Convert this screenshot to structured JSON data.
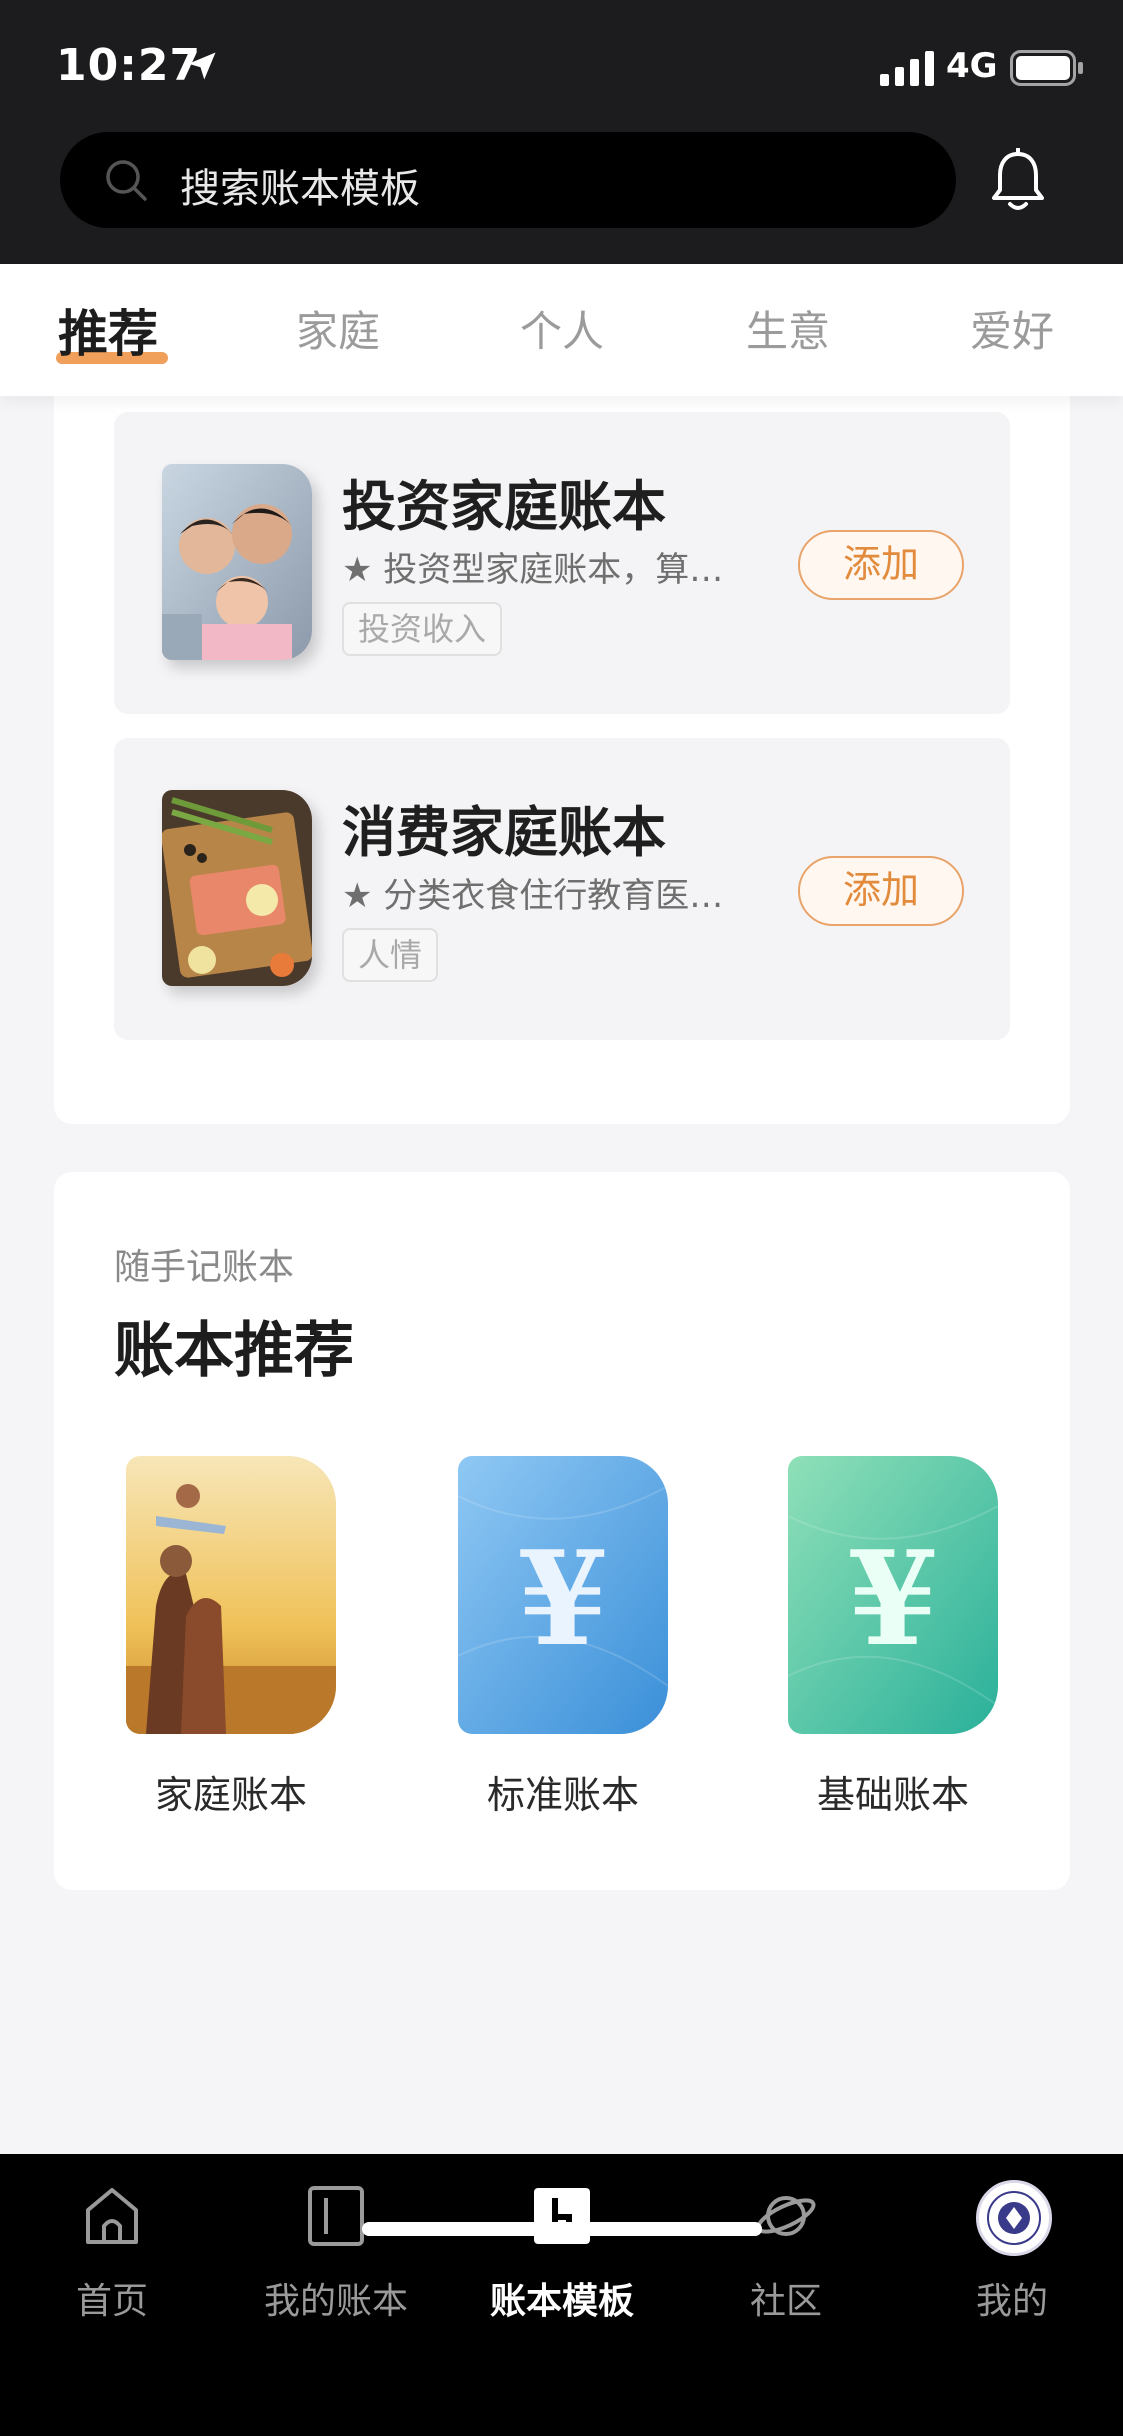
{
  "status": {
    "time": "10:27",
    "network": "4G"
  },
  "search": {
    "placeholder": "搜索账本模板"
  },
  "tabs": [
    {
      "label": "推荐",
      "active": true
    },
    {
      "label": "家庭",
      "active": false
    },
    {
      "label": "个人",
      "active": false
    },
    {
      "label": "生意",
      "active": false
    },
    {
      "label": "爱好",
      "active": false
    }
  ],
  "books": [
    {
      "title": "投资家庭账本",
      "desc": "★ 投资型家庭账本，算…",
      "tag": "投资收入",
      "add_label": "添加"
    },
    {
      "title": "消费家庭账本",
      "desc": "★ 分类衣食住行教育医…",
      "tag": "人情",
      "add_label": "添加"
    }
  ],
  "recommend": {
    "subtitle": "随手记账本",
    "title": "账本推荐",
    "items": [
      {
        "label": "家庭账本"
      },
      {
        "label": "标准账本"
      },
      {
        "label": "基础账本"
      }
    ]
  },
  "bottom_nav": [
    {
      "label": "首页",
      "icon": "home-icon",
      "active": false
    },
    {
      "label": "我的账本",
      "icon": "book-icon",
      "active": false
    },
    {
      "label": "账本模板",
      "icon": "template-icon",
      "active": true
    },
    {
      "label": "社区",
      "icon": "planet-icon",
      "active": false
    },
    {
      "label": "我的",
      "icon": "avatar",
      "active": false
    }
  ],
  "colors": {
    "accent": "#e28b3c",
    "header_bg": "#1c1c1e",
    "nav_bg": "#000000"
  }
}
